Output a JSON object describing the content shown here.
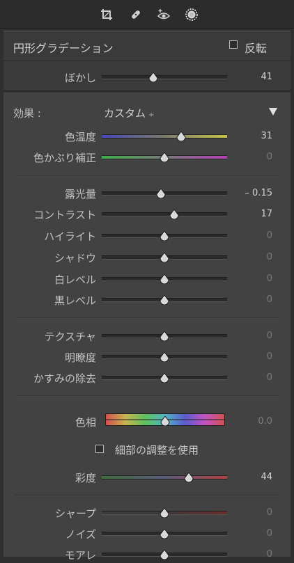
{
  "toolbar": {
    "tools": [
      {
        "icon": "crop-icon"
      },
      {
        "icon": "healing-brush-icon"
      },
      {
        "icon": "red-eye-icon"
      },
      {
        "icon": "radial-filter-icon",
        "active": true
      }
    ]
  },
  "header": {
    "title": "円形グラデーション",
    "invert_label": "反転",
    "invert_checked": false,
    "feather": {
      "label": "ぼかし",
      "value": "41",
      "position": 0.41
    }
  },
  "effect": {
    "label": "効果 :",
    "preset": "カスタム",
    "preset_caret": "÷"
  },
  "sliders": {
    "temp": {
      "label": "色温度",
      "value": "31",
      "position": 0.635
    },
    "tint": {
      "label": "色かぶり補正",
      "value": "0",
      "position": 0.5
    },
    "exposure": {
      "label": "露光量",
      "value": "– 0.15",
      "position": 0.47
    },
    "contrast": {
      "label": "コントラスト",
      "value": "17",
      "position": 0.575
    },
    "highlights": {
      "label": "ハイライト",
      "value": "0",
      "position": 0.5
    },
    "shadows": {
      "label": "シャドウ",
      "value": "0",
      "position": 0.5
    },
    "whites": {
      "label": "白レベル",
      "value": "0",
      "position": 0.5
    },
    "blacks": {
      "label": "黒レベル",
      "value": "0",
      "position": 0.5
    },
    "texture": {
      "label": "テクスチャ",
      "value": "0",
      "position": 0.5
    },
    "clarity": {
      "label": "明瞭度",
      "value": "0",
      "position": 0.5
    },
    "dehaze": {
      "label": "かすみの除去",
      "value": "0",
      "position": 0.5
    },
    "hue": {
      "label": "色相",
      "value": "0.0",
      "position": 0.5
    },
    "saturation": {
      "label": "彩度",
      "value": "44",
      "position": 0.695
    },
    "sharpness": {
      "label": "シャープ",
      "value": "0",
      "position": 0.5
    },
    "noise": {
      "label": "ノイズ",
      "value": "0",
      "position": 0.5
    },
    "moire": {
      "label": "モアレ",
      "value": "0",
      "position": 0.5
    }
  },
  "fine_adjust": {
    "label": "細部の調整を使用",
    "checked": false
  },
  "colors": {
    "accent_temp_low": "#4448b8",
    "accent_temp_high": "#c7c34b",
    "tint_low": "#3fae4b",
    "tint_high": "#b640b6"
  }
}
